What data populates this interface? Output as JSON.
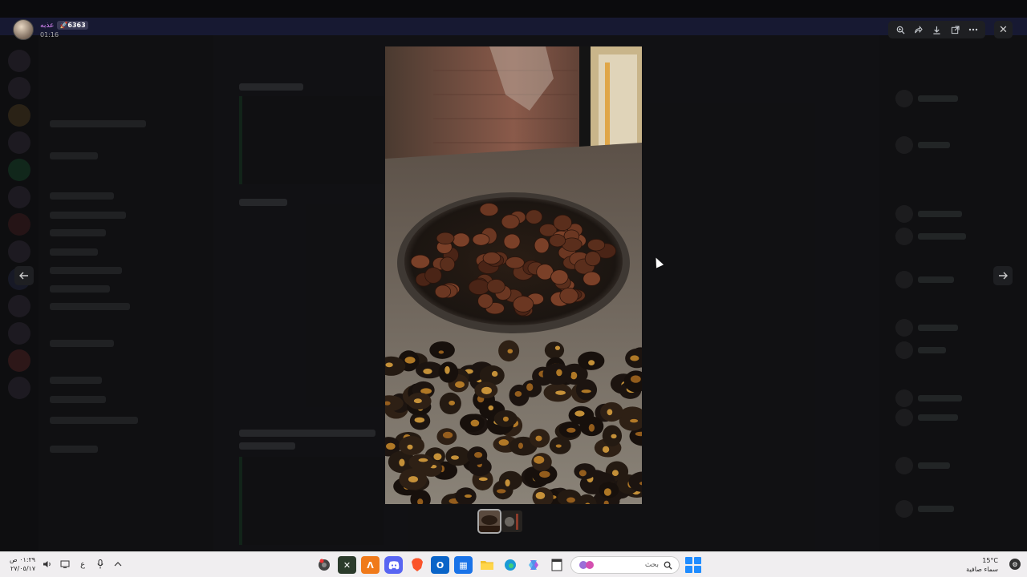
{
  "viewer": {
    "user": {
      "name": "عذبه",
      "badge": "🚀6363",
      "time": "01:16"
    },
    "toolbar": {
      "zoom_icon": "zoom-in-icon",
      "forward_icon": "forward-icon",
      "download_icon": "download-icon",
      "open_icon": "open-external-icon",
      "more_icon": "more-icon"
    },
    "close_icon": "close-icon",
    "prev_icon": "arrow-left-icon",
    "next_icon": "arrow-right-icon",
    "image_subject": "roasted chestnuts on a pan and counter",
    "thumbnail_count": 2
  },
  "taskbar": {
    "time": "٠١:٢٩ ص",
    "date": "٢٧/٠٥/١٧",
    "lang": "ع",
    "search_placeholder": "بحث",
    "weather_temp": "15°C",
    "weather_desc": "سماء صافية",
    "apps": [
      "chrome",
      "terminal",
      "app-a",
      "discord",
      "brave",
      "outlook",
      "store",
      "files",
      "edge",
      "copilot",
      "notepad"
    ]
  }
}
